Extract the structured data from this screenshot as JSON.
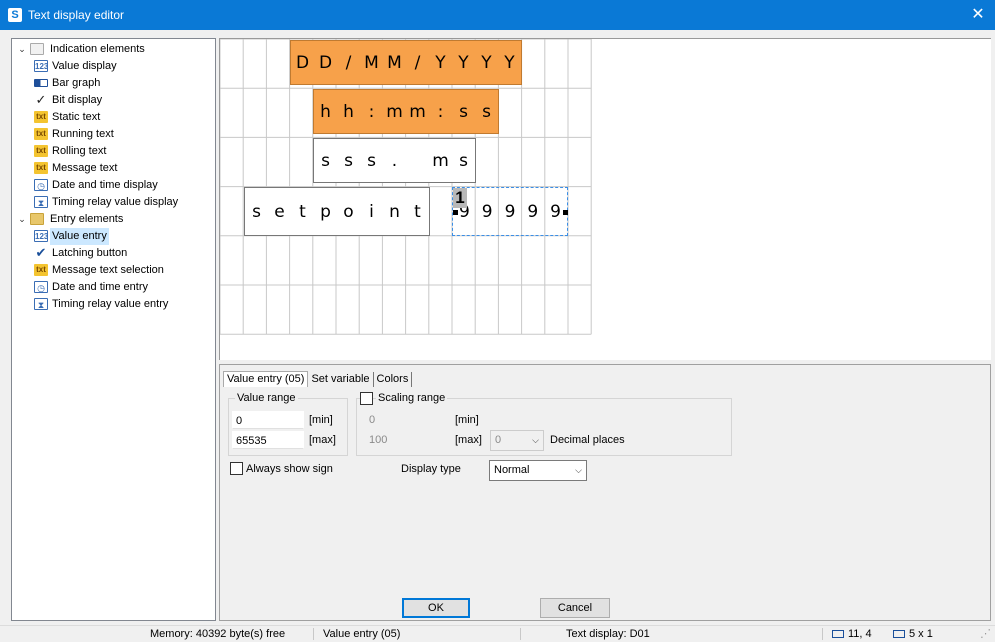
{
  "window": {
    "title": "Text display editor",
    "app_icon": "S",
    "close_icon": "✕"
  },
  "tree": {
    "groups": [
      {
        "label": "Indication elements",
        "icon": "folder-open-icon",
        "items": [
          {
            "label": "Value display",
            "icon": "value-display-icon"
          },
          {
            "label": "Bar graph",
            "icon": "bar-graph-icon"
          },
          {
            "label": "Bit display",
            "icon": "checkmark-icon"
          },
          {
            "label": "Static text",
            "icon": "static-text-icon"
          },
          {
            "label": "Running text",
            "icon": "running-text-icon"
          },
          {
            "label": "Rolling text",
            "icon": "rolling-text-icon"
          },
          {
            "label": "Message text",
            "icon": "message-text-icon"
          },
          {
            "label": "Date and time display",
            "icon": "date-time-icon"
          },
          {
            "label": "Timing relay value display",
            "icon": "timing-relay-icon"
          }
        ]
      },
      {
        "label": "Entry elements",
        "icon": "folder-closed-icon",
        "items": [
          {
            "label": "Value entry",
            "icon": "value-entry-icon",
            "selected": true
          },
          {
            "label": "Latching button",
            "icon": "latching-button-icon"
          },
          {
            "label": "Message text selection",
            "icon": "message-selection-icon"
          },
          {
            "label": "Date and time entry",
            "icon": "date-time-entry-icon"
          },
          {
            "label": "Timing relay value entry",
            "icon": "timing-relay-entry-icon"
          }
        ]
      }
    ]
  },
  "display": {
    "date_element": [
      "D",
      "D",
      "/",
      "M",
      "M",
      "/",
      "Y",
      "Y",
      "Y",
      "Y"
    ],
    "time_element": [
      "h",
      "h",
      ":",
      "m",
      "m",
      ":",
      "s",
      "s"
    ],
    "ms_element": [
      "s",
      "s",
      "s",
      ".",
      "",
      "m",
      "s"
    ],
    "setpoint_text": [
      "s",
      "e",
      "t",
      "p",
      "o",
      "i",
      "n",
      "t"
    ],
    "value_entry": [
      "9",
      "9",
      "9",
      "9",
      "9"
    ],
    "value_entry_badge": "1",
    "highlight_color": "#f7a14a"
  },
  "props": {
    "tabs": [
      "Value entry (05)",
      "Set variable",
      "Colors"
    ],
    "value_range": {
      "title": "Value range",
      "min_value": "0",
      "min_unit": "[min]",
      "max_value": "65535",
      "max_unit": "[max]"
    },
    "scaling_range": {
      "title": "Scaling range",
      "min_value": "0",
      "min_unit": "[min]",
      "max_value": "100",
      "max_unit": "[max]",
      "decimal_value": "0",
      "decimal_label": "Decimal places"
    },
    "always_show_sign": "Always show sign",
    "display_type_label": "Display type",
    "display_type_value": "Normal"
  },
  "buttons": {
    "ok": "OK",
    "cancel": "Cancel"
  },
  "status": {
    "memory": "Memory: 40392 byte(s) free",
    "element": "Value entry (05)",
    "display": "Text display: D01",
    "position": "11, 4",
    "size": "5 x 1"
  }
}
